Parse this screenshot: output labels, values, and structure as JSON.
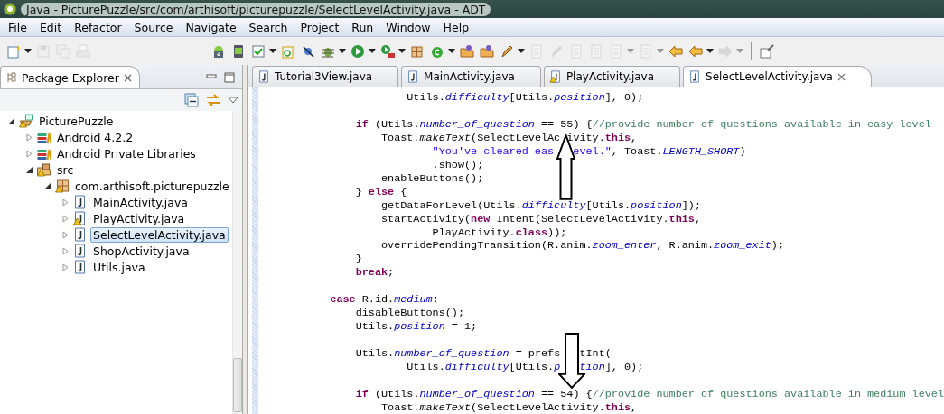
{
  "window": {
    "title": "Java - PicturePuzzle/src/com/arthisoft/picturepuzzle/SelectLevelActivity.java - ADT"
  },
  "menu": [
    {
      "label": "File"
    },
    {
      "label": "Edit"
    },
    {
      "label": "Refactor"
    },
    {
      "label": "Source"
    },
    {
      "label": "Navigate"
    },
    {
      "label": "Search"
    },
    {
      "label": "Project"
    },
    {
      "label": "Run"
    },
    {
      "label": "Window"
    },
    {
      "label": "Help"
    }
  ],
  "toolbar": {
    "groups": [
      [
        {
          "kind": "new",
          "disabled": false,
          "menu": true
        },
        {
          "kind": "save",
          "disabled": true,
          "menu": false
        },
        {
          "kind": "saveall",
          "disabled": true,
          "menu": false
        },
        {
          "kind": "print",
          "disabled": true,
          "menu": false
        }
      ],
      [
        {
          "kind": "android",
          "disabled": false,
          "menu": false
        },
        {
          "kind": "device",
          "disabled": false,
          "menu": false
        },
        {
          "kind": "checkbox",
          "disabled": false,
          "menu": true
        },
        {
          "kind": "newclass",
          "disabled": false,
          "menu": false
        },
        {
          "kind": "lint",
          "disabled": false,
          "menu": false
        },
        {
          "kind": "debug",
          "disabled": false,
          "menu": true
        },
        {
          "kind": "run",
          "disabled": false,
          "menu": true
        },
        {
          "kind": "external",
          "disabled": false,
          "menu": true
        },
        {
          "kind": "package",
          "disabled": false,
          "menu": false
        },
        {
          "kind": "class",
          "disabled": false,
          "menu": true
        },
        {
          "kind": "folder",
          "disabled": false,
          "menu": false
        },
        {
          "kind": "folder",
          "disabled": false,
          "menu": false
        },
        {
          "kind": "pen",
          "disabled": false,
          "menu": true
        },
        {
          "kind": "generic",
          "disabled": true,
          "menu": false
        },
        {
          "kind": "pen",
          "disabled": true,
          "menu": false
        },
        {
          "kind": "generic",
          "disabled": true,
          "menu": false
        },
        {
          "kind": "generic",
          "disabled": true,
          "menu": false
        },
        {
          "kind": "generic",
          "disabled": true,
          "menu": true
        },
        {
          "kind": "generic",
          "disabled": true,
          "menu": true
        },
        {
          "kind": "back",
          "disabled": false,
          "menu": false
        },
        {
          "kind": "back",
          "disabled": false,
          "menu": true
        },
        {
          "kind": "forward",
          "disabled": true,
          "menu": true
        }
      ],
      [
        {
          "kind": "pin",
          "disabled": false,
          "menu": false
        }
      ]
    ]
  },
  "explorer": {
    "title": "Package Explorer",
    "tree": [
      {
        "label": "PicturePuzzle",
        "kind": "project",
        "warning": true,
        "expanded": true,
        "selected": false,
        "children": [
          {
            "label": "Android 4.2.2",
            "kind": "library",
            "warning": false,
            "expanded": false,
            "selected": false
          },
          {
            "label": "Android Private Libraries",
            "kind": "library",
            "warning": false,
            "expanded": false,
            "selected": false
          },
          {
            "label": "src",
            "kind": "source",
            "warning": true,
            "expanded": true,
            "selected": false,
            "children": [
              {
                "label": "com.arthisoft.picturepuzzle",
                "kind": "package",
                "warning": true,
                "expanded": true,
                "selected": false,
                "children": [
                  {
                    "label": "MainActivity.java",
                    "kind": "java",
                    "warning": false,
                    "expanded": false,
                    "selected": false
                  },
                  {
                    "label": "PlayActivity.java",
                    "kind": "java",
                    "warning": true,
                    "expanded": false,
                    "selected": false
                  },
                  {
                    "label": "SelectLevelActivity.java",
                    "kind": "java",
                    "warning": false,
                    "expanded": false,
                    "selected": true
                  },
                  {
                    "label": "ShopActivity.java",
                    "kind": "java",
                    "warning": false,
                    "expanded": false,
                    "selected": false
                  },
                  {
                    "label": "Utils.java",
                    "kind": "java",
                    "warning": false,
                    "expanded": false,
                    "selected": false
                  }
                ]
              }
            ]
          }
        ]
      }
    ]
  },
  "editor": {
    "tabs": [
      {
        "label": "Tutorial3View.java",
        "warning": false,
        "selected": false
      },
      {
        "label": "MainActivity.java",
        "warning": false,
        "selected": false
      },
      {
        "label": "PlayActivity.java",
        "warning": true,
        "selected": false
      },
      {
        "label": "SelectLevelActivity.java",
        "warning": false,
        "selected": true
      }
    ],
    "lines": [
      {
        "kind": "code",
        "tokens": [
          {
            "kind": "plain",
            "text": "                    Utils."
          },
          {
            "kind": "field",
            "text": "difficulty"
          },
          {
            "kind": "plain",
            "text": "[Utils."
          },
          {
            "kind": "field",
            "text": "position"
          },
          {
            "kind": "plain",
            "text": "], 0);"
          }
        ]
      },
      {
        "kind": "blank"
      },
      {
        "kind": "code",
        "tokens": [
          {
            "kind": "keyword",
            "text": "            if"
          },
          {
            "kind": "plain",
            "text": " (Utils."
          },
          {
            "kind": "field",
            "text": "number_of_question"
          },
          {
            "kind": "plain",
            "text": " == 55) {"
          },
          {
            "kind": "comment",
            "text": "//provide number of questions available in easy level"
          }
        ]
      },
      {
        "kind": "code",
        "tokens": [
          {
            "kind": "plain",
            "text": "                Toast."
          },
          {
            "kind": "static",
            "text": "makeText"
          },
          {
            "kind": "plain",
            "text": "(SelectLevelAc "
          },
          {
            "kind": "plain",
            "text": "ivity."
          },
          {
            "kind": "keyword",
            "text": "this"
          },
          {
            "kind": "plain",
            "text": ","
          }
        ]
      },
      {
        "kind": "code",
        "tokens": [
          {
            "kind": "string",
            "text": "                        \"You've cleared eas   "
          },
          {
            "kind": "string",
            "text": "evel.\""
          },
          {
            "kind": "plain",
            "text": ", Toast."
          },
          {
            "kind": "field",
            "text": "LENGTH_SHORT"
          },
          {
            "kind": "plain",
            "text": ")"
          }
        ]
      },
      {
        "kind": "code",
        "tokens": [
          {
            "kind": "plain",
            "text": "                        .show();"
          }
        ]
      },
      {
        "kind": "code",
        "tokens": [
          {
            "kind": "plain",
            "text": "                enableButtons();"
          }
        ]
      },
      {
        "kind": "code",
        "tokens": [
          {
            "kind": "plain",
            "text": "            } "
          },
          {
            "kind": "keyword",
            "text": "else"
          },
          {
            "kind": "plain",
            "text": " {"
          }
        ]
      },
      {
        "kind": "code",
        "tokens": [
          {
            "kind": "plain",
            "text": "                getDataForLevel(Utils."
          },
          {
            "kind": "field",
            "text": "difficulty"
          },
          {
            "kind": "plain",
            "text": "[Utils."
          },
          {
            "kind": "field",
            "text": "position"
          },
          {
            "kind": "plain",
            "text": "]);"
          }
        ]
      },
      {
        "kind": "code",
        "tokens": [
          {
            "kind": "plain",
            "text": "                startActivity("
          },
          {
            "kind": "keyword",
            "text": "new"
          },
          {
            "kind": "plain",
            "text": " Intent(SelectLevelActivity."
          },
          {
            "kind": "keyword",
            "text": "this"
          },
          {
            "kind": "plain",
            "text": ","
          }
        ]
      },
      {
        "kind": "code",
        "tokens": [
          {
            "kind": "plain",
            "text": "                        PlayActivity."
          },
          {
            "kind": "keyword",
            "text": "class"
          },
          {
            "kind": "plain",
            "text": "));"
          }
        ]
      },
      {
        "kind": "code",
        "tokens": [
          {
            "kind": "plain",
            "text": "                overridePendingTransition(R.anim."
          },
          {
            "kind": "field",
            "text": "zoom_enter"
          },
          {
            "kind": "plain",
            "text": ", R.anim."
          },
          {
            "kind": "field",
            "text": "zoom_exit"
          },
          {
            "kind": "plain",
            "text": ");"
          }
        ]
      },
      {
        "kind": "code",
        "tokens": [
          {
            "kind": "plain",
            "text": "            }"
          }
        ]
      },
      {
        "kind": "code",
        "tokens": [
          {
            "kind": "keyword",
            "text": "            break"
          },
          {
            "kind": "plain",
            "text": ";"
          }
        ]
      },
      {
        "kind": "blank"
      },
      {
        "kind": "code",
        "tokens": [
          {
            "kind": "keyword",
            "text": "        case"
          },
          {
            "kind": "plain",
            "text": " R.id."
          },
          {
            "kind": "field",
            "text": "medium"
          },
          {
            "kind": "plain",
            "text": ":"
          }
        ]
      },
      {
        "kind": "code",
        "tokens": [
          {
            "kind": "plain",
            "text": "            disableButtons();"
          }
        ]
      },
      {
        "kind": "code",
        "tokens": [
          {
            "kind": "plain",
            "text": "            Utils."
          },
          {
            "kind": "field",
            "text": "position"
          },
          {
            "kind": "plain",
            "text": " = 1;"
          }
        ]
      },
      {
        "kind": "blank"
      },
      {
        "kind": "code",
        "tokens": [
          {
            "kind": "plain",
            "text": "            Utils."
          },
          {
            "kind": "field",
            "text": "number_of_question"
          },
          {
            "kind": "plain",
            "text": " = prefs   "
          },
          {
            "kind": "plain",
            "text": "tInt("
          }
        ]
      },
      {
        "kind": "code",
        "tokens": [
          {
            "kind": "plain",
            "text": "                    Utils."
          },
          {
            "kind": "field",
            "text": "difficulty"
          },
          {
            "kind": "plain",
            "text": "[Utils."
          },
          {
            "kind": "field",
            "text": "p   "
          },
          {
            "kind": "field",
            "text": "tion"
          },
          {
            "kind": "plain",
            "text": "], 0);"
          }
        ]
      },
      {
        "kind": "blank"
      },
      {
        "kind": "code",
        "tokens": [
          {
            "kind": "keyword",
            "text": "            if"
          },
          {
            "kind": "plain",
            "text": " (Utils."
          },
          {
            "kind": "field",
            "text": "number_of_question"
          },
          {
            "kind": "plain",
            "text": " == 54) {"
          },
          {
            "kind": "comment",
            "text": "//provide number of questions available in medium level"
          }
        ]
      },
      {
        "kind": "code",
        "tokens": [
          {
            "kind": "plain",
            "text": "                Toast."
          },
          {
            "kind": "static",
            "text": "makeText"
          },
          {
            "kind": "plain",
            "text": "(SelectLevelActivity."
          },
          {
            "kind": "keyword",
            "text": "this"
          },
          {
            "kind": "plain",
            "text": ","
          }
        ]
      }
    ],
    "annotations": [
      {
        "kind": "up"
      },
      {
        "kind": "down"
      }
    ]
  }
}
